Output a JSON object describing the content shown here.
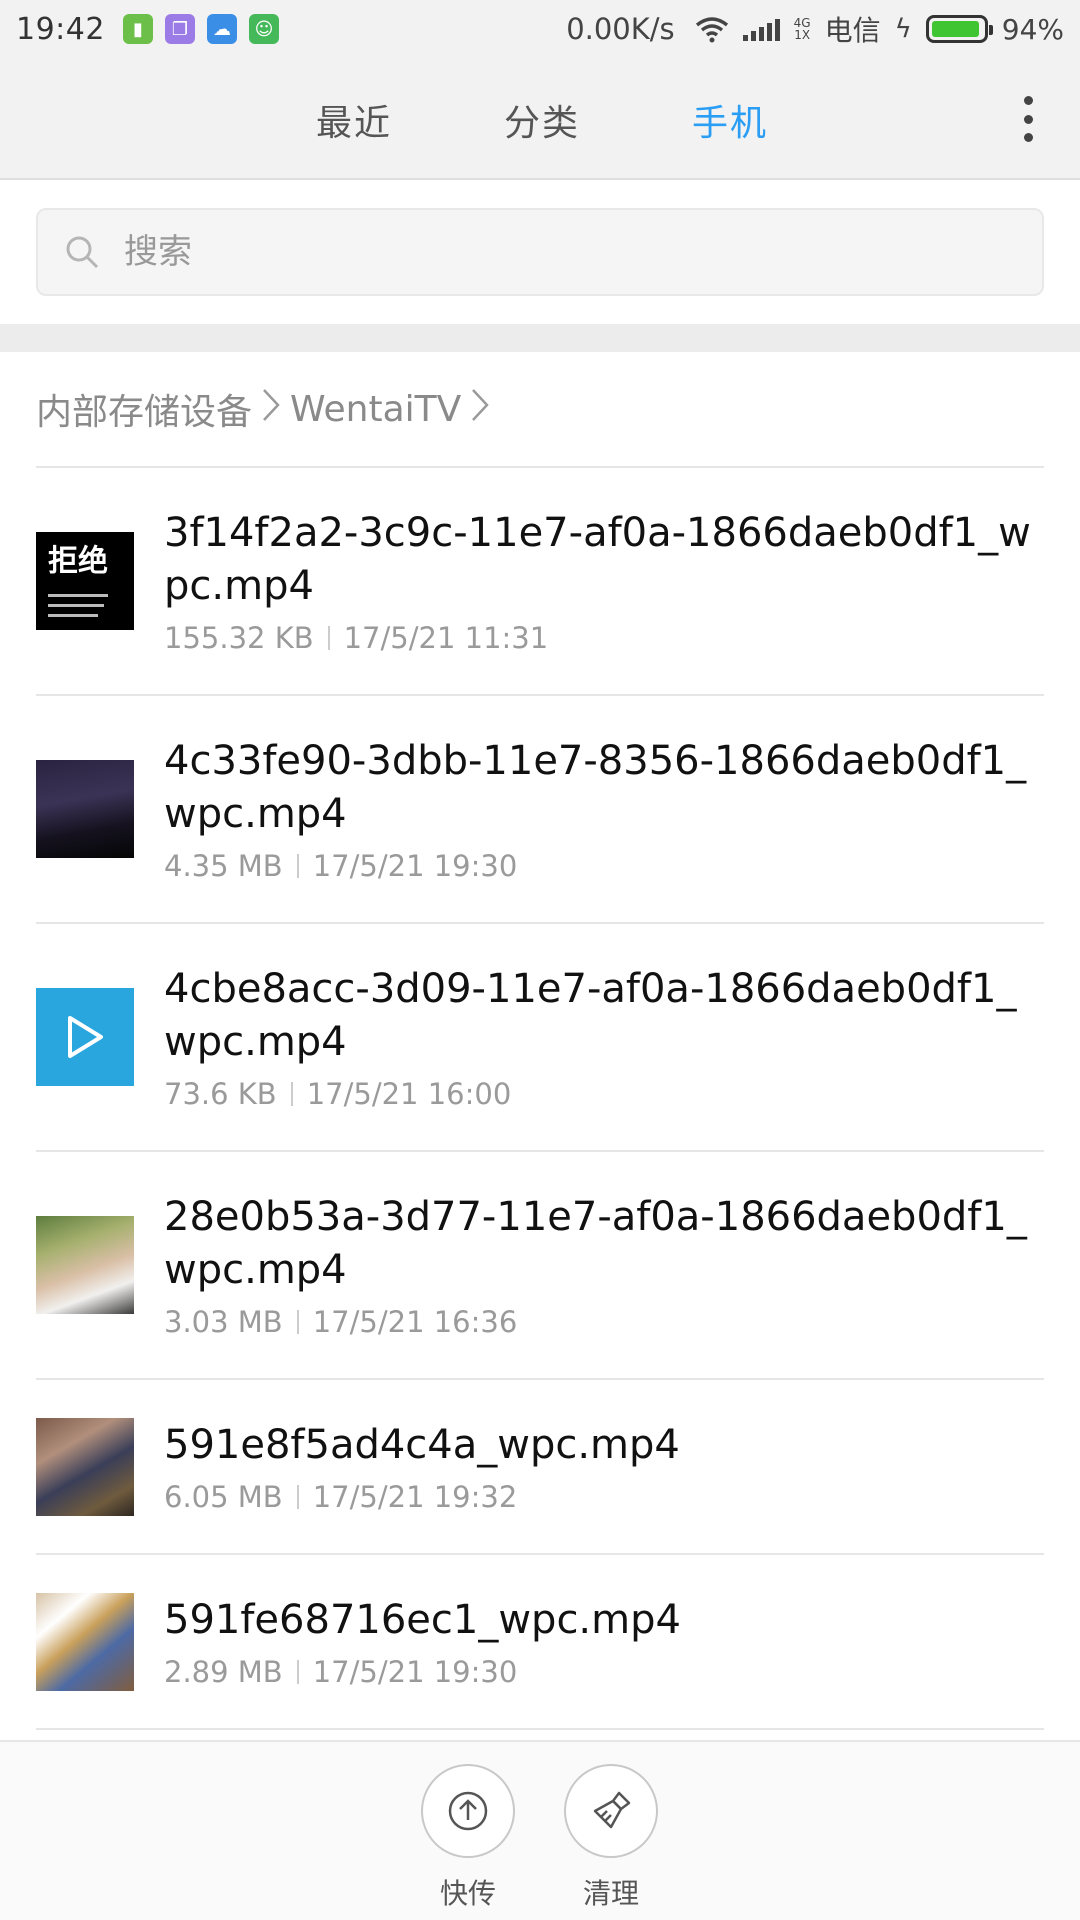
{
  "status_bar": {
    "time": "19:42",
    "net_speed": "0.00K/s",
    "network_type_top": "4G",
    "network_type_bottom": "1X",
    "carrier": "电信",
    "battery_percent": "94%",
    "battery_level": 0.94,
    "app_icons": [
      "sim-app-icon",
      "notes-app-icon",
      "cloud-app-icon",
      "android-app-icon"
    ]
  },
  "tabs": [
    {
      "label": "最近",
      "active": false
    },
    {
      "label": "分类",
      "active": false
    },
    {
      "label": "手机",
      "active": true
    }
  ],
  "search": {
    "placeholder": "搜索"
  },
  "breadcrumb": [
    "内部存储设备",
    "WentaiTV"
  ],
  "thumb1_text": "拒绝",
  "files": [
    {
      "name": "3f14f2a2-3c9c-11e7-af0a-1866daeb0df1_wpc.mp4",
      "size": "155.32 KB",
      "date": "17/5/21 11:31"
    },
    {
      "name": "4c33fe90-3dbb-11e7-8356-1866daeb0df1_wpc.mp4",
      "size": "4.35 MB",
      "date": "17/5/21 19:30"
    },
    {
      "name": "4cbe8acc-3d09-11e7-af0a-1866daeb0df1_wpc.mp4",
      "size": "73.6 KB",
      "date": "17/5/21 16:00"
    },
    {
      "name": "28e0b53a-3d77-11e7-af0a-1866daeb0df1_wpc.mp4",
      "size": "3.03 MB",
      "date": "17/5/21 16:36"
    },
    {
      "name": "591e8f5ad4c4a_wpc.mp4",
      "size": "6.05 MB",
      "date": "17/5/21 19:32"
    },
    {
      "name": "591fe68716ec1_wpc.mp4",
      "size": "2.89 MB",
      "date": "17/5/21 19:30"
    }
  ],
  "bottom_bar": {
    "transfer_label": "快传",
    "clean_label": "清理"
  },
  "colors": {
    "accent": "#2a9df4",
    "video_placeholder": "#2aa6df",
    "battery": "#3fc532"
  }
}
